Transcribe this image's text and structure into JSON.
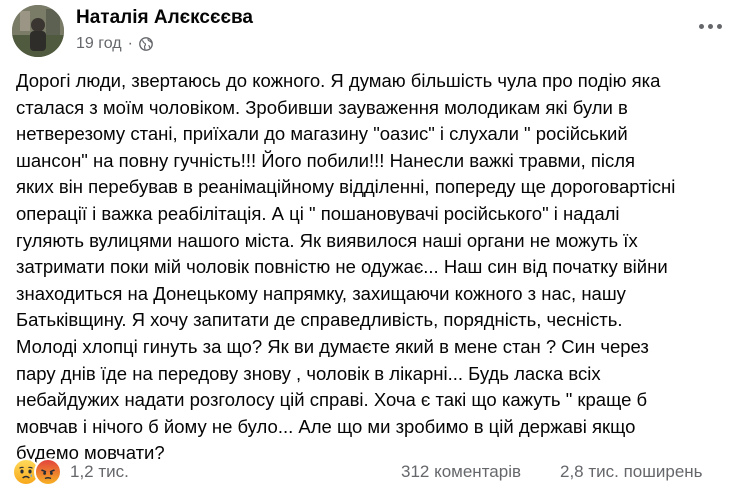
{
  "post": {
    "author": "Наталія Алєксєєва",
    "time": "19 год",
    "separator": "·",
    "audience_icon": "globe-icon",
    "more_icon": "more-options-icon",
    "text_lines": [
      "Дорогі люди, звертаюсь до кожного. Я думаю більшість чула про подію яка",
      "сталася з моїм чоловіком. Зробивши зауваження молодикам які були в",
      "нетверезому стані, приїхали до магазину \"оазис\" і слухали \" російський",
      "шансон\" на повну гучність!!! Його  побили!!! Нанесли важкі травми, після",
      "яких він перебував в реанімаційному відділенні, попереду ще дороговартісні",
      "операції і важка реабілітація. А ці \" пошановувачі російського\" і надалі",
      "гуляють вулицями нашого міста. Як виявилося наші органи не можуть їх",
      "затримати поки мій чоловік повністю не одужає... Наш син від початку війни",
      "знаходиться на Донецькому напрямку, захищаючи кожного з нас, нашу",
      "Батьківщину. Я хочу запитати де справедливість, порядність, чесність.",
      "Молоді хлопці гинуть за що? Як ви думаєте який в мене стан ? Син через",
      "пару днів їде на передову знову , чоловік в лікарні... Будь ласка всіх",
      "небайдужих надати розголосу цій справі. Хоча є такі що кажуть \" краще б",
      "мовчав і нічого б йому не було... Але що ми зробимо в цій державі якщо",
      "будемо мовчати?"
    ]
  },
  "footer": {
    "reactions": [
      {
        "icon": "sad-reaction-icon",
        "color": "#f7b125"
      },
      {
        "icon": "angry-reaction-icon",
        "color": "#e9710f"
      }
    ],
    "reaction_count": "1,2 тис.",
    "comments": "312 коментарів",
    "shares": "2,8 тис. поширень"
  }
}
